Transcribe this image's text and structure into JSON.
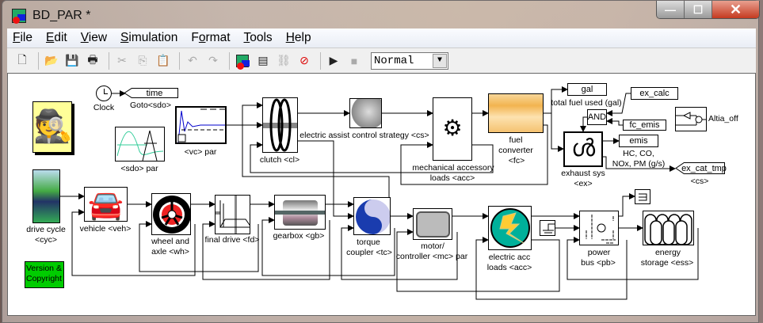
{
  "window": {
    "title": "BD_PAR *",
    "buttons": {
      "minimize": "—",
      "maximize": "☐",
      "close": "✕"
    }
  },
  "menu": [
    {
      "label": "File",
      "key": "F",
      "rest": "ile"
    },
    {
      "label": "Edit",
      "key": "E",
      "rest": "dit"
    },
    {
      "label": "View",
      "key": "V",
      "rest": "iew"
    },
    {
      "label": "Simulation",
      "key": "S",
      "rest": "imulation"
    },
    {
      "label": "Format",
      "key": "o",
      "pre": "F",
      "rest": "rmat"
    },
    {
      "label": "Tools",
      "key": "T",
      "rest": "ools"
    },
    {
      "label": "Help",
      "key": "H",
      "rest": "elp"
    }
  ],
  "toolbar": {
    "sim_mode": "Normal",
    "icons": [
      "new-icon",
      "open-icon",
      "save-icon",
      "print-icon",
      "cut-icon",
      "copy-icon",
      "paste-icon",
      "undo-icon",
      "redo-icon",
      "library-browser-icon",
      "model-explorer-icon",
      "debugger-icon",
      "build-icon",
      "start-icon",
      "stop-icon"
    ]
  },
  "blocks": {
    "clock": "Clock",
    "time_goto": "time",
    "goto_label": "Goto<sdo>",
    "sdo_par": "<sdo> par",
    "vc_par": "<vc> par",
    "clutch": "clutch <cl>",
    "cs": "electric assist control strategy <cs>",
    "mech": [
      "mechanical accessory",
      "loads <acc>"
    ],
    "fc": [
      "fuel",
      "converter",
      "<fc>"
    ],
    "gal": "gal",
    "gal_label": "total fuel used (gal)",
    "ex_calc": "ex_calc",
    "and": "AND",
    "fc_emis": "fc_emis",
    "altia": "Altia_off",
    "exhaust": [
      "exhaust sys",
      "<ex>"
    ],
    "emis": "emis",
    "emis_label": [
      "HC, CO,",
      "NOx, PM (g/s)"
    ],
    "ex_cat_tmp": "ex_cat_tmp",
    "ex_cat_label": "<cs>",
    "drive_cycle": [
      "drive cycle",
      "<cyc>"
    ],
    "version": [
      "Version &",
      "Copyright"
    ],
    "vehicle": "vehicle <veh>",
    "wheel": [
      "wheel and",
      "axle <wh>"
    ],
    "final_drive": "final drive <fd>",
    "gearbox": "gearbox <gb>",
    "torque": [
      "torque",
      "coupler <tc>"
    ],
    "motor": [
      "motor/",
      "controller <mc> par"
    ],
    "elec_acc": [
      "electric acc",
      "loads <acc>"
    ],
    "power_bus": [
      "power",
      "bus <pb>"
    ],
    "ess": [
      "energy",
      "storage <ess>"
    ]
  },
  "colors": {
    "version_bg": "#00cc00",
    "help_bg": "#ffff99",
    "elec_acc": "#00b09a",
    "bolt": "#ffcc33",
    "wire": "#000000"
  }
}
